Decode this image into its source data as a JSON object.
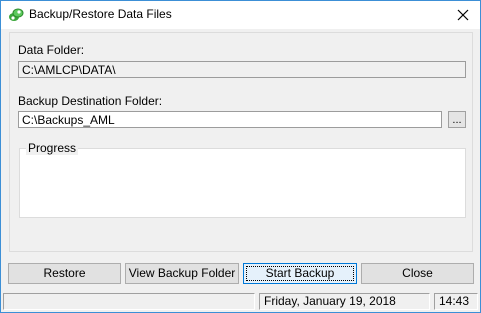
{
  "window": {
    "title": "Backup/Restore Data Files",
    "icon": "app-icon",
    "close_icon": "close-icon"
  },
  "form": {
    "data_folder_label": "Data Folder:",
    "data_folder_value": "C:\\AMLCP\\DATA\\",
    "backup_dest_label": "Backup Destination Folder:",
    "backup_dest_value": "C:\\Backups_AML",
    "browse_label": "...",
    "progress_label": "Progress"
  },
  "buttons": {
    "restore": "Restore",
    "view_backup_folder": "View Backup Folder",
    "start_backup": "Start Backup",
    "close": "Close"
  },
  "status": {
    "message": "",
    "date": "Friday, January 19, 2018",
    "time": "14:43"
  }
}
